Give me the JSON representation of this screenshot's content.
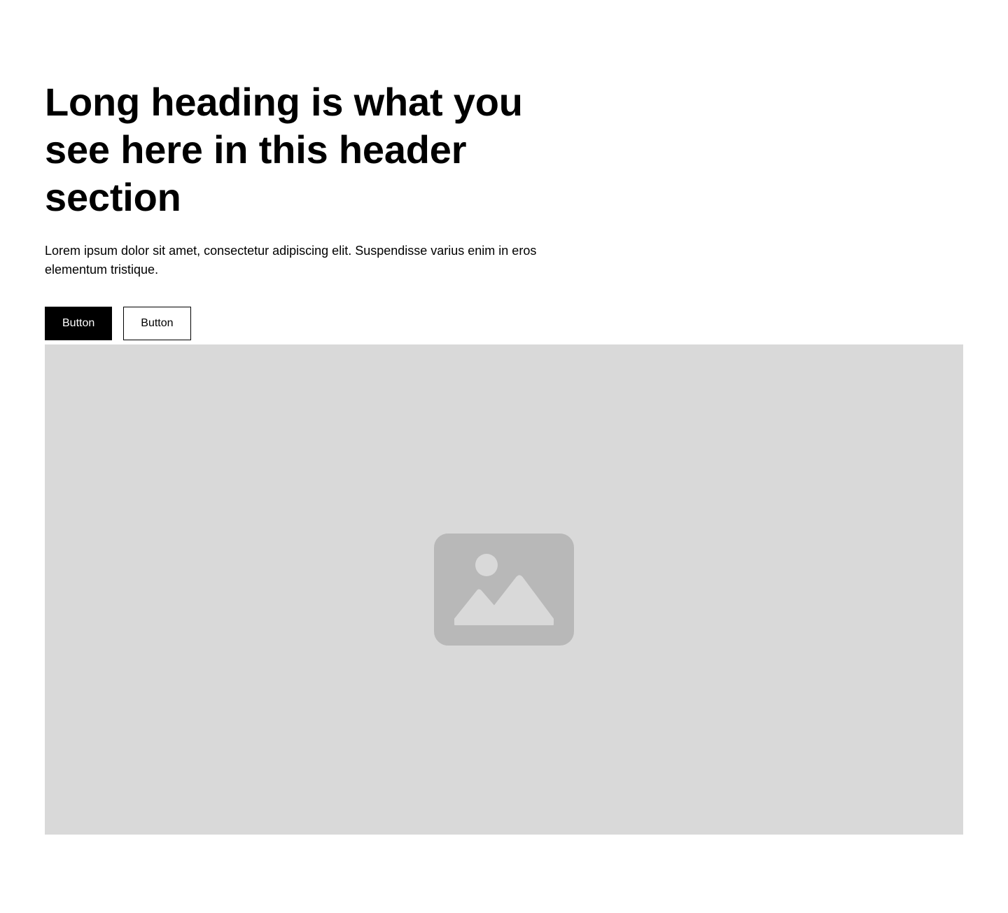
{
  "header": {
    "heading": "Long heading is what you see here in this header section",
    "body": "Lorem ipsum dolor sit amet, consectetur adipiscing elit. Suspendisse varius enim in eros elementum tristique.",
    "primary_button_label": "Button",
    "secondary_button_label": "Button"
  },
  "media": {
    "icon": "image-icon",
    "background_color": "#d9d9d9",
    "icon_color": "#b8b8b8"
  }
}
